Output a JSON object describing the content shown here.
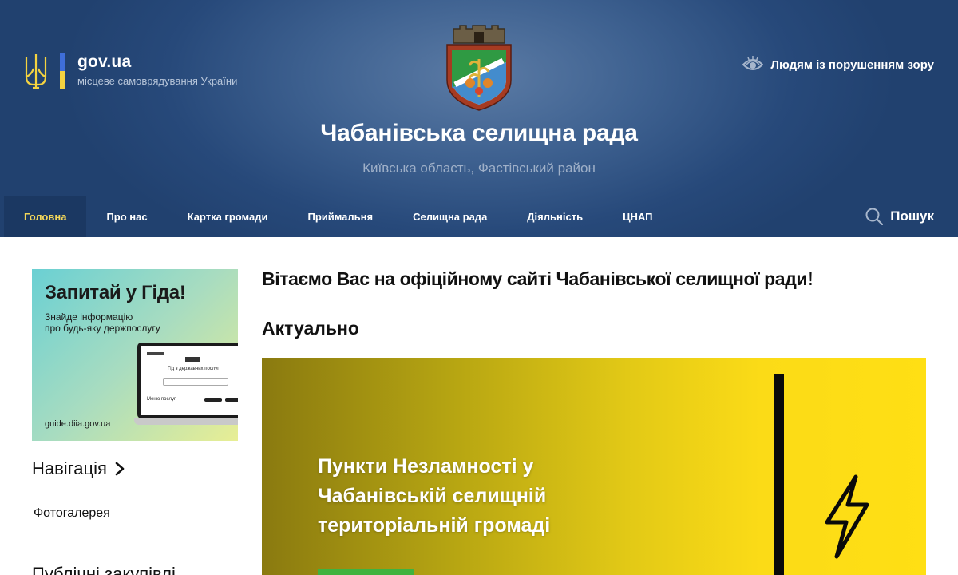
{
  "brand": {
    "title": "gov.ua",
    "subtitle": "місцеве самоврядування України"
  },
  "site": {
    "title": "Чабанівська селищна рада",
    "subtitle": "Київська область, Фастівський район"
  },
  "accessibility": {
    "label": "Людям із порушенням зору",
    "icon": "eye-icon"
  },
  "nav": {
    "items": [
      {
        "label": "Головна",
        "active": true
      },
      {
        "label": "Про нас",
        "active": false
      },
      {
        "label": "Картка громади",
        "active": false
      },
      {
        "label": "Приймальня",
        "active": false
      },
      {
        "label": "Селищна рада",
        "active": false
      },
      {
        "label": "Діяльність",
        "active": false
      },
      {
        "label": "ЦНАП",
        "active": false
      }
    ],
    "search_label": "Пошук"
  },
  "sidebar": {
    "banner": {
      "title": "Запитай у Гіда!",
      "line1": "Знайде інформацію",
      "line2": "про будь-яку держпослугу",
      "url": "guide.diia.gov.ua",
      "screen_heading": "Гід з державних послуг",
      "screen_menu": "Меню послуг"
    },
    "navigation_heading": "Навігація",
    "links": [
      "Фотогалерея"
    ],
    "next_heading": "Публічні закупівлі"
  },
  "main": {
    "welcome": "Вітаємо Вас на офіційному сайті Чабанівської селищної ради!",
    "section_title": "Актуально",
    "news": {
      "title_lines": [
        "Пункти Незламності у",
        "Чабанівській селищній",
        "територіальній громаді"
      ]
    }
  },
  "colors": {
    "header_bg": "#27497a",
    "nav_active_bg": "#1b3862",
    "nav_active_text": "#f2d65a",
    "flag_blue": "#3f6ed8",
    "flag_yellow": "#f5d340"
  }
}
